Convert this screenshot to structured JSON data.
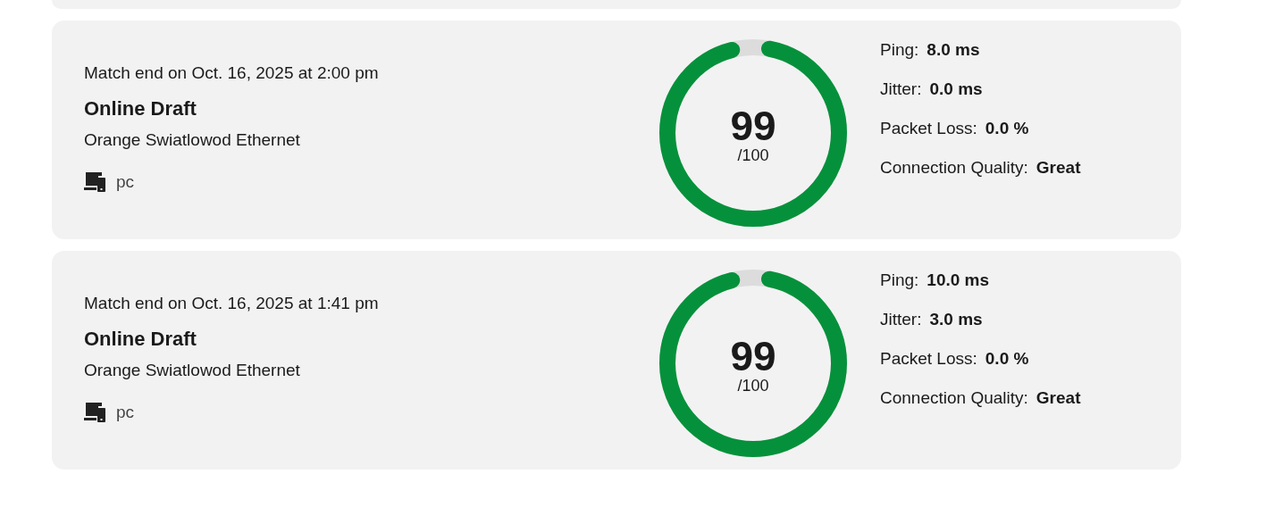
{
  "matches": [
    {
      "match_end": "Match end on Oct. 16, 2025 at 2:00 pm",
      "mode": "Online Draft",
      "network": "Orange Swiatlowod Ethernet",
      "platform": "pc",
      "score": "99",
      "score_max": "/100",
      "level": 0.99,
      "stats": [
        {
          "label": "Ping:",
          "value": "8.0 ms"
        },
        {
          "label": "Jitter:",
          "value": "0.0 ms"
        },
        {
          "label": "Packet Loss:",
          "value": "0.0 %"
        },
        {
          "label": "Connection Quality:",
          "value": "Great"
        }
      ]
    },
    {
      "match_end": "Match end on Oct. 16, 2025 at 1:41 pm",
      "mode": "Online Draft",
      "network": "Orange Swiatlowod Ethernet",
      "platform": "pc",
      "score": "99",
      "score_max": "/100",
      "level": 0.99,
      "stats": [
        {
          "label": "Ping:",
          "value": "10.0 ms"
        },
        {
          "label": "Jitter:",
          "value": "3.0 ms"
        },
        {
          "label": "Packet Loss:",
          "value": "0.0 %"
        },
        {
          "label": "Connection Quality:",
          "value": "Great"
        }
      ]
    }
  ]
}
